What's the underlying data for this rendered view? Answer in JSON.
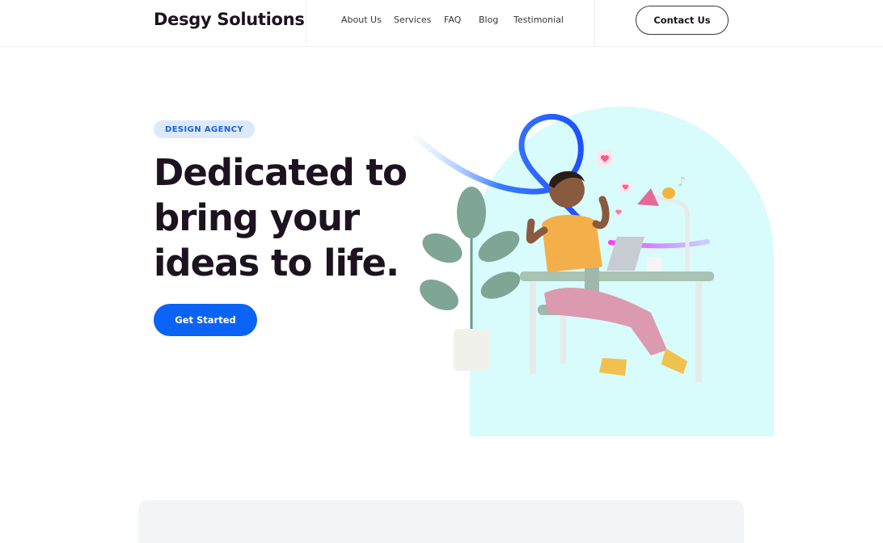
{
  "header": {
    "logo": "Desgy Solutions",
    "nav": [
      {
        "label": "About Us"
      },
      {
        "label": "Services"
      },
      {
        "label": "FAQ"
      },
      {
        "label": "Blog"
      },
      {
        "label": "Testimonial"
      }
    ],
    "contact_label": "Contact Us"
  },
  "hero": {
    "badge": "DESIGN AGENCY",
    "headline_lines": [
      "Dedicated to",
      "bring your",
      "ideas to life."
    ],
    "cta_label": "Get Started"
  },
  "colors": {
    "accent": "#0b63f6",
    "badge_bg": "#dde9fb",
    "badge_text": "#1a63d8",
    "illustration_bg": "#d8fbfc",
    "text": "#1d1320"
  },
  "icons": {
    "illustration": "woman-at-desk-illustration"
  }
}
